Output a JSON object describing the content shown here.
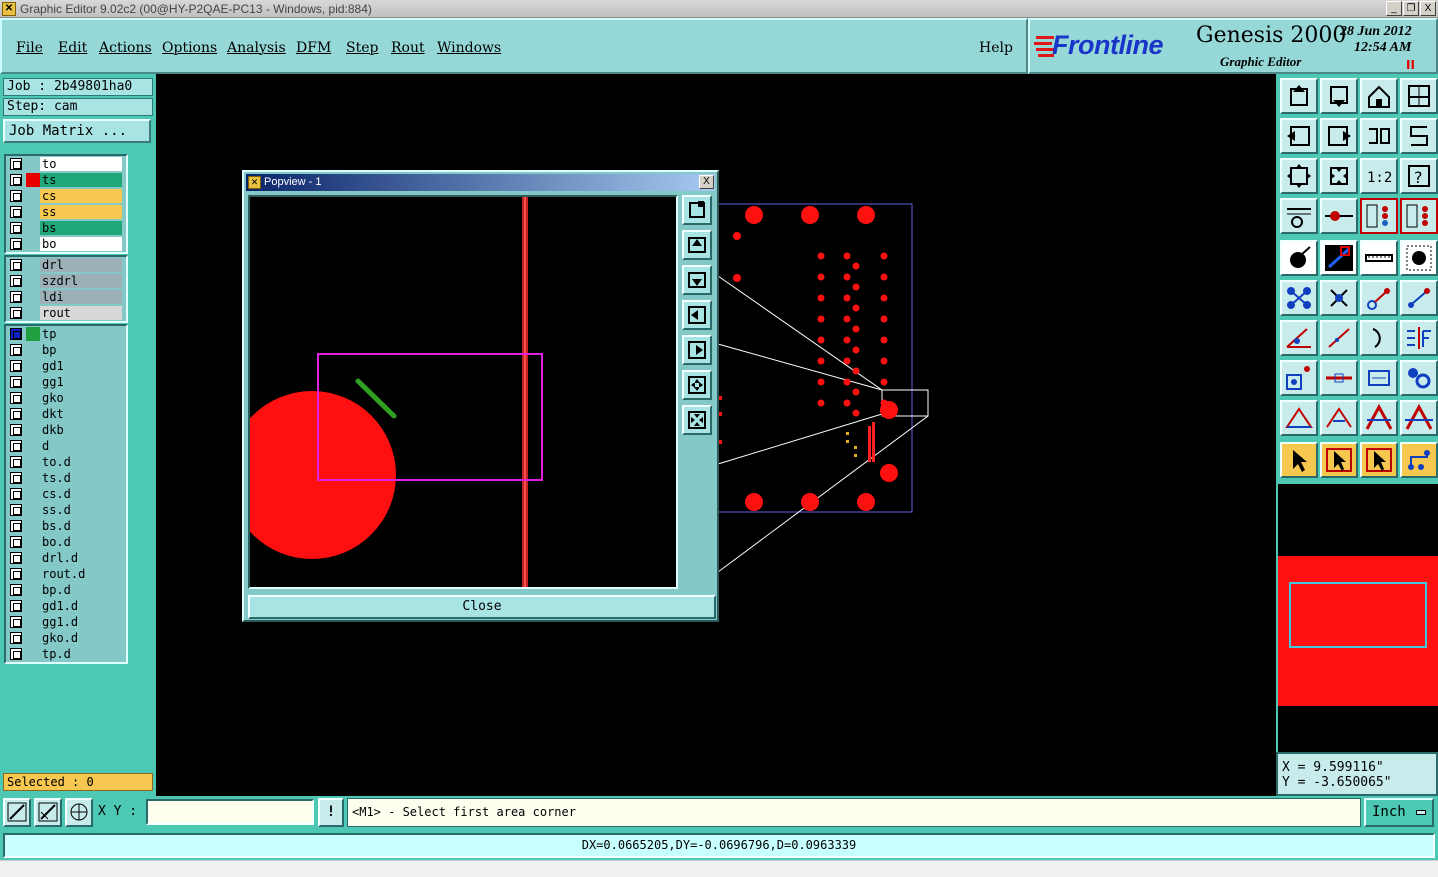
{
  "window": {
    "title": "Graphic Editor 9.02c2 (00@HY-P2QAE-PC13 - Windows, pid:884)",
    "controls": [
      "_",
      "❐",
      "X"
    ]
  },
  "menu": [
    "File",
    "Edit",
    "Actions",
    "Options",
    "Analysis",
    "DFM",
    "Step",
    "Rout",
    "Windows"
  ],
  "help_label": "Help",
  "logo": {
    "brand": "Frontline",
    "product": "Genesis 2000",
    "subtitle": "Graphic Editor",
    "date": "28 Jun 2012",
    "time": "12:54 AM",
    "indicator": "II"
  },
  "job": {
    "job_label": "Job : 2b49801ha0",
    "step_label": "Step: cam",
    "matrix_button": "Job Matrix ..."
  },
  "layer_groups": [
    [
      {
        "name": "to",
        "bg": "#ffffff",
        "swatch": null
      },
      {
        "name": "ts",
        "bg": "#20a878",
        "swatch": "#e80000"
      },
      {
        "name": "cs",
        "bg": "#f6c850",
        "swatch": null
      },
      {
        "name": "ss",
        "bg": "#f6c850",
        "swatch": null
      },
      {
        "name": "bs",
        "bg": "#20a878",
        "swatch": null
      },
      {
        "name": "bo",
        "bg": "#ffffff",
        "swatch": null
      }
    ],
    [
      {
        "name": "drl",
        "bg": "#9cb0b8",
        "swatch": null
      },
      {
        "name": "szdrl",
        "bg": "#9cb0b8",
        "swatch": null
      },
      {
        "name": "ldi",
        "bg": "#9cb0b8",
        "swatch": null
      },
      {
        "name": "rout",
        "bg": "#d8d8d8",
        "swatch": null
      }
    ],
    [
      {
        "name": "tp",
        "bg": "#84c8c8",
        "swatch": "#20a040",
        "active": true
      },
      {
        "name": "bp",
        "bg": "#84c8c8",
        "swatch": null
      },
      {
        "name": "gd1",
        "bg": "#84c8c8",
        "swatch": null
      },
      {
        "name": "gg1",
        "bg": "#84c8c8",
        "swatch": null
      },
      {
        "name": "gko",
        "bg": "#84c8c8",
        "swatch": null
      },
      {
        "name": "dkt",
        "bg": "#84c8c8",
        "swatch": null
      },
      {
        "name": "dkb",
        "bg": "#84c8c8",
        "swatch": null
      },
      {
        "name": "d",
        "bg": "#84c8c8",
        "swatch": null
      },
      {
        "name": "to.d",
        "bg": "#84c8c8",
        "swatch": null
      },
      {
        "name": "ts.d",
        "bg": "#84c8c8",
        "swatch": null
      },
      {
        "name": "cs.d",
        "bg": "#84c8c8",
        "swatch": null
      },
      {
        "name": "ss.d",
        "bg": "#84c8c8",
        "swatch": null
      },
      {
        "name": "bs.d",
        "bg": "#84c8c8",
        "swatch": null
      },
      {
        "name": "bo.d",
        "bg": "#84c8c8",
        "swatch": null
      },
      {
        "name": "drl.d",
        "bg": "#84c8c8",
        "swatch": null
      },
      {
        "name": "rout.d",
        "bg": "#84c8c8",
        "swatch": null
      },
      {
        "name": "bp.d",
        "bg": "#84c8c8",
        "swatch": null
      },
      {
        "name": "gd1.d",
        "bg": "#84c8c8",
        "swatch": null
      },
      {
        "name": "gg1.d",
        "bg": "#84c8c8",
        "swatch": null
      },
      {
        "name": "gko.d",
        "bg": "#84c8c8",
        "swatch": null
      },
      {
        "name": "tp.d",
        "bg": "#84c8c8",
        "swatch": null
      }
    ]
  ],
  "selected_label": "Selected : 0",
  "popview": {
    "title": "Popview - 1",
    "close_label": "Close",
    "close_x": "X"
  },
  "coordinates": {
    "x": "X = 9.599116\"",
    "y": "Y = -3.650065\""
  },
  "bottom": {
    "xy_label": "X Y :",
    "xy_value": "",
    "bang": "!",
    "prompt": "<M1> - Select first area corner",
    "unit": "Inch"
  },
  "status": "DX=0.0665205,DY=-0.0696796,D=0.0963339",
  "colors": {
    "panel": "#4cc8b4",
    "menu": "#96d8d8",
    "feature_red": "#ff0000",
    "selection_magenta": "#e020e0"
  }
}
